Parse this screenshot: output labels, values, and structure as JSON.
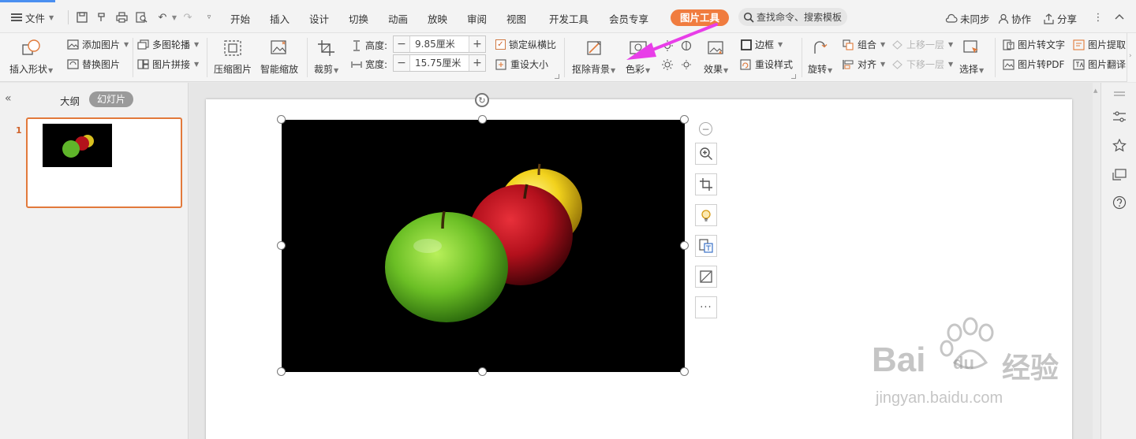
{
  "menubar": {
    "file_label": "文件",
    "tabs": [
      "开始",
      "插入",
      "设计",
      "切换",
      "动画",
      "放映",
      "审阅",
      "视图",
      "开发工具",
      "会员专享"
    ],
    "picture_tool_tab": "图片工具",
    "search_placeholder": "查找命令、搜索模板",
    "unsynced": "未同步",
    "collaborate": "协作",
    "share": "分享"
  },
  "ribbon": {
    "insert_shape": "插入形状",
    "add_picture": "添加图片",
    "replace_picture": "替换图片",
    "multi_carousel": "多图轮播",
    "picture_stitch": "图片拼接",
    "compress": "压缩图片",
    "smart_zoom": "智能缩放",
    "crop": "裁剪",
    "height_label": "高度:",
    "height_value": "9.85厘米",
    "width_label": "宽度:",
    "width_value": "15.75厘米",
    "lock_ratio": "锁定纵横比",
    "reset_size": "重设大小",
    "remove_bg": "抠除背景",
    "color": "色彩",
    "effects": "效果",
    "border": "边框",
    "reset_style": "重设样式",
    "rotate": "旋转",
    "group": "组合",
    "align": "对齐",
    "bring_forward": "上移一层",
    "send_backward": "下移一层",
    "select": "选择",
    "pic_to_text": "图片转文字",
    "pic_to_pdf": "图片转PDF",
    "pic_extract": "图片提取",
    "pic_translate": "图片翻译"
  },
  "leftpanel": {
    "outline_tab": "大纲",
    "slides_tab": "幻灯片",
    "slide_number": "1"
  },
  "watermark": {
    "brand": "Bai",
    "brand2": "du",
    "cn": "经验",
    "url": "jingyan.baidu.com"
  },
  "colors": {
    "accent_orange": "#f07c3f",
    "arrow_magenta": "#e83ee8"
  }
}
